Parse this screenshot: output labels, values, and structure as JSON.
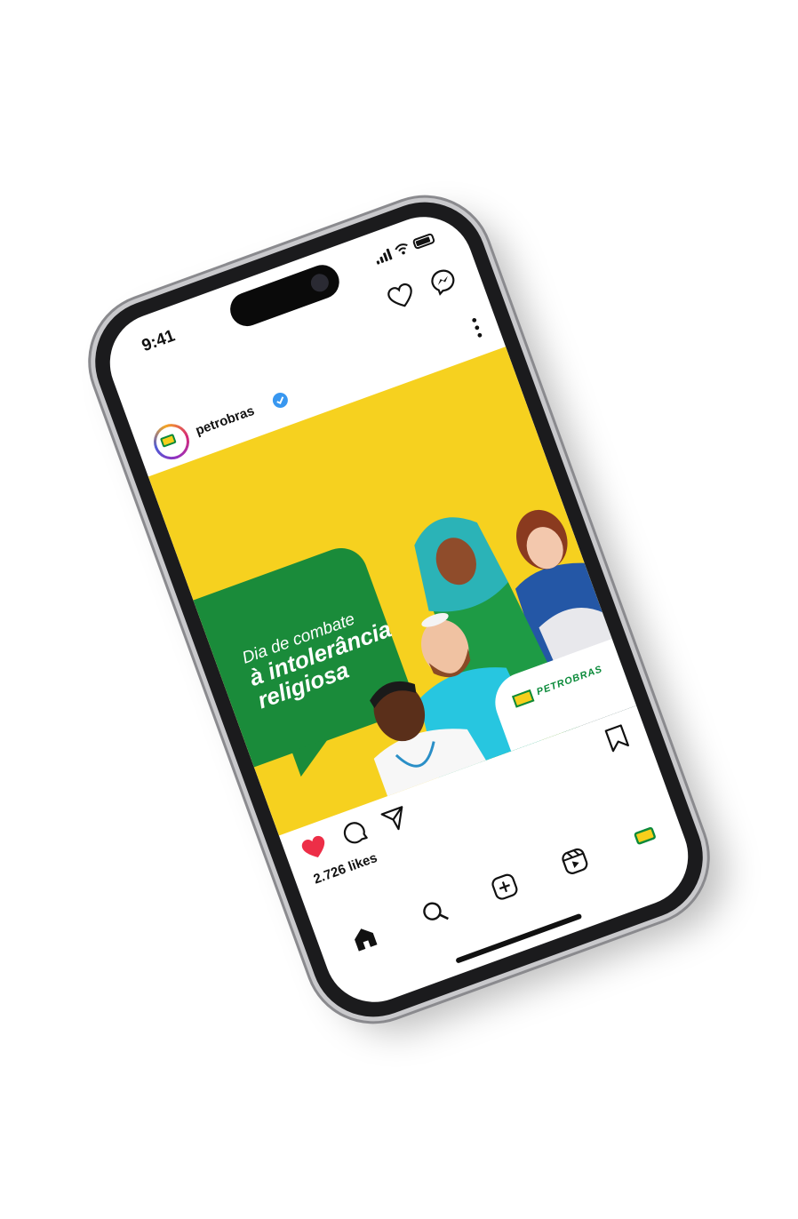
{
  "status_bar": {
    "time": "9:41"
  },
  "top_icons": [
    "heart-icon",
    "messenger-icon"
  ],
  "post": {
    "username": "petrobras",
    "verified": true,
    "headline_line1": "Dia de combate",
    "headline_line2": "à intolerância",
    "headline_line3": "religiosa",
    "brand_tag": "PETROBRAS",
    "likes": "2.726 likes",
    "liked": true
  },
  "actions": [
    "heart-icon",
    "comment-icon",
    "share-icon",
    "bookmark-icon"
  ],
  "tabbar": [
    "home-icon",
    "search-icon",
    "create-icon",
    "reels-icon",
    "profile-icon"
  ],
  "colors": {
    "post_background": "#f6d11f",
    "bubble_green": "#1a8b3a",
    "like_red": "#ed2e47",
    "verified_blue": "#3897f0"
  }
}
